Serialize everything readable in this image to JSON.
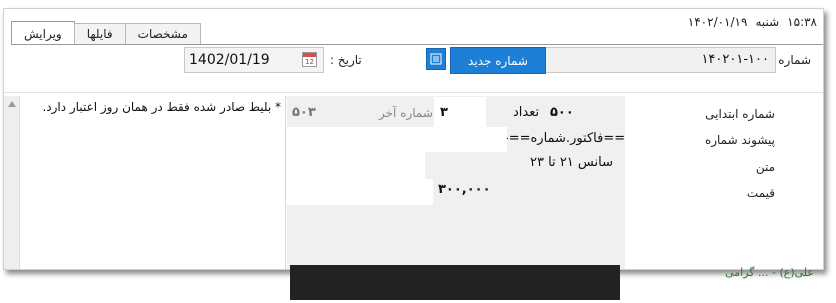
{
  "status": {
    "time": "۱۵:۳۸",
    "weekday": "شنبه",
    "date": "۱۴۰۲/۰۱/۱۹"
  },
  "tabs": [
    {
      "label": "ویرایش",
      "active": true
    },
    {
      "label": "فایلها",
      "active": false
    },
    {
      "label": "مشخصات",
      "active": false
    }
  ],
  "header": {
    "number_label": "شماره :",
    "number_value": "۱۴۰۲۰۱-۱۰۰",
    "new_number_button": "شماره جدید",
    "date_label": "تاریخ :",
    "date_value": "1402/01/19",
    "calendar_day": "12"
  },
  "note": {
    "text": "* بلیط صادر شده فقط در همان روز اعتبار دارد."
  },
  "form": {
    "start_number_label": "شماره ابتدایی",
    "start_number_value": "۵۰۰",
    "count_label": "تعداد",
    "count_value": "۳",
    "last_number_label": "شماره آخر",
    "last_number_value": "۵۰۳",
    "prefix_label": "پیشوند شماره",
    "prefix_value": "==فاکتور.شماره==-",
    "text_label": "متن",
    "text_value": "سانس ۲۱ تا ۲۳",
    "price_label": "قیمت",
    "price_value": "۳۰۰,۰۰۰"
  },
  "bottom": {
    "footer_partial": "علی(ع) - ... گرامی"
  },
  "colors": {
    "accent": "#1e7fd6",
    "field_bg": "#f0f0f0"
  }
}
